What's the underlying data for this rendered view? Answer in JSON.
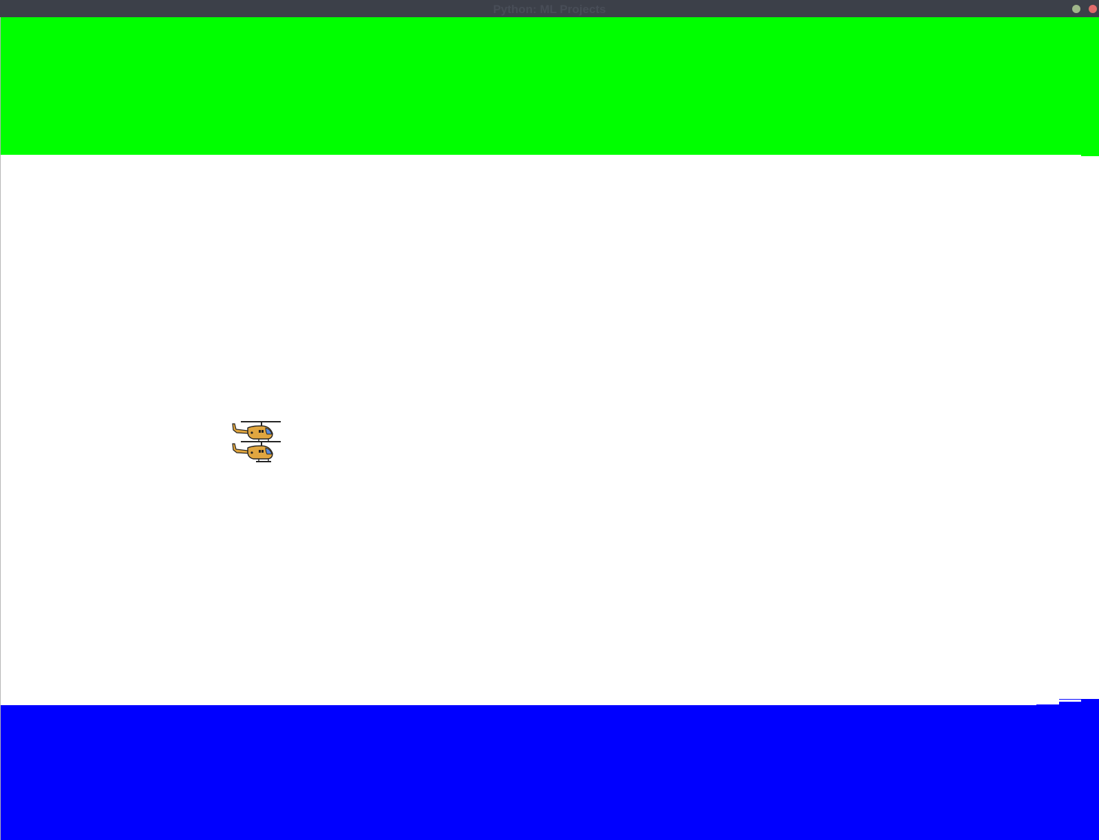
{
  "window": {
    "title": "Python: ML Projects",
    "titlebar_color": "#3c4049",
    "minimize_button_color": "#9fb58a",
    "close_button_color": "#e06b6b"
  },
  "game": {
    "background_color": "#ffffff",
    "top_wall_color": "#00ff00",
    "bottom_wall_color": "#0000ff",
    "helicopters": [
      {
        "name": "helicopter",
        "icon": "helicopter-icon"
      },
      {
        "name": "helicopter",
        "icon": "helicopter-icon"
      }
    ]
  }
}
